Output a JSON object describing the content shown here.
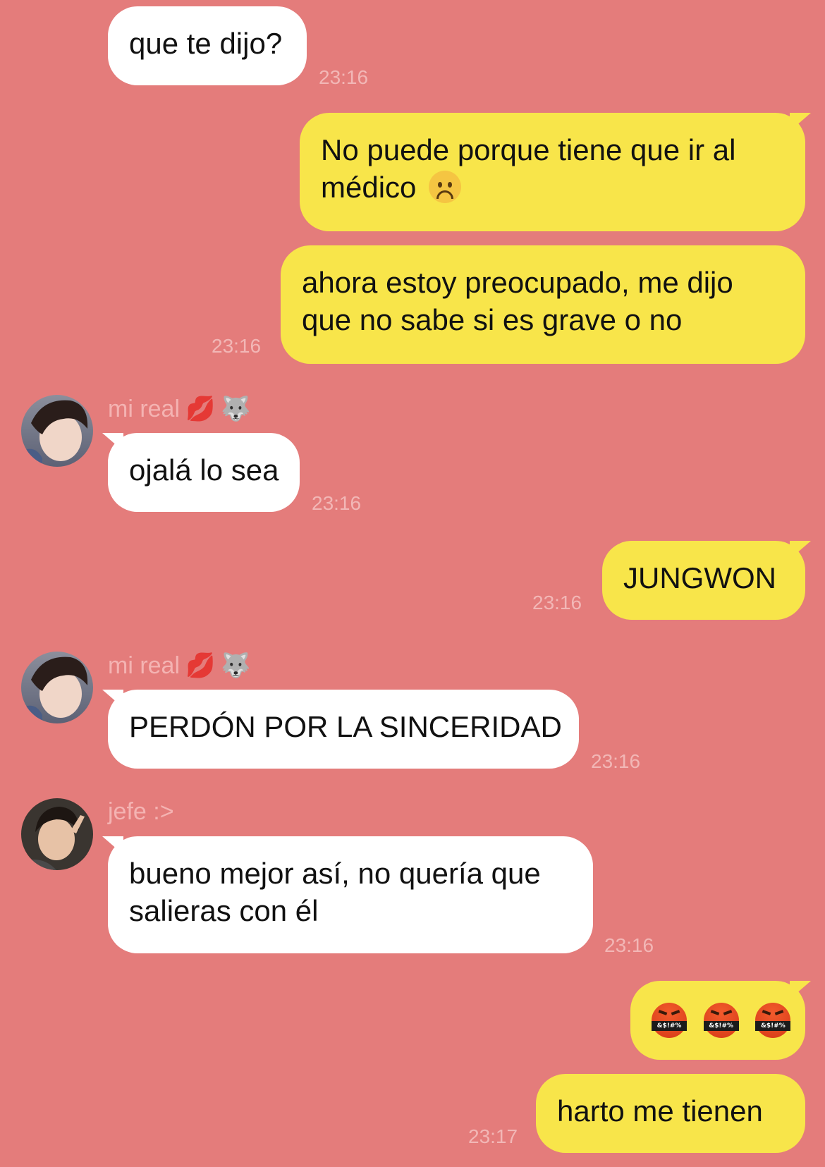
{
  "theme": {
    "background": "#e47c7b",
    "incoming_bubble": "#ffffff",
    "outgoing_bubble": "#f8e54a",
    "timestamp_color": "#f2b7b6"
  },
  "messages": [
    {
      "side": "in",
      "text": "que te dijo?",
      "time": "23:16"
    },
    {
      "side": "out",
      "line1": "No puede porque tiene que ir al",
      "line2": "médico",
      "emoji": "frowning-face-icon"
    },
    {
      "side": "out",
      "line1": "ahora estoy preocupado, me dijo",
      "line2": "que no sabe si es grave o no",
      "time": "23:16"
    },
    {
      "side": "in",
      "sender": "mi real",
      "sender_emoji1": "💋",
      "sender_emoji2": "🐺",
      "text": "ojalá lo sea",
      "time": "23:16"
    },
    {
      "side": "out",
      "text": "JUNGWON",
      "time": "23:16"
    },
    {
      "side": "in",
      "sender": "mi real",
      "sender_emoji1": "💋",
      "sender_emoji2": "🐺",
      "text": "PERDÓN POR LA SINCERIDAD",
      "time": "23:16"
    },
    {
      "side": "in",
      "sender": "jefe :>",
      "line1": "bueno mejor así, no quería que",
      "line2": "salieras con él",
      "time": "23:16"
    },
    {
      "side": "out",
      "emojis": [
        "angry-face-with-symbols-icon",
        "angry-face-with-symbols-icon",
        "angry-face-with-symbols-icon"
      ],
      "symbol_text": "&$!#%"
    },
    {
      "side": "out",
      "text": "harto me tienen",
      "time": "23:17"
    }
  ]
}
